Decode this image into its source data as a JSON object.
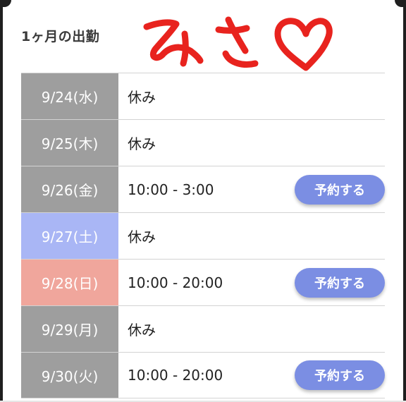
{
  "header": {
    "title": "1ヶ月の出勤",
    "signature": "みさ♡"
  },
  "schedule": [
    {
      "date": "9/24(水)",
      "text": "休み",
      "button": ""
    },
    {
      "date": "9/25(木)",
      "text": "休み",
      "button": ""
    },
    {
      "date": "9/26(金)",
      "text": "10:00 - 3:00",
      "button": "予約する"
    },
    {
      "date": "9/27(土)",
      "text": "休み",
      "button": ""
    },
    {
      "date": "9/28(日)",
      "text": "10:00 - 20:00",
      "button": "予約する"
    },
    {
      "date": "9/29(月)",
      "text": "休み",
      "button": ""
    },
    {
      "date": "9/30(火)",
      "text": "10:00 - 20:00",
      "button": "予約する"
    }
  ],
  "colors": {
    "weekday_date_bg": "#9e9e9e",
    "saturday_date_bg": "#a9b6f5",
    "sunday_date_bg": "#f0a69c",
    "reserve_button_bg": "#7b8ee3",
    "signature_ink": "#e8231e"
  }
}
